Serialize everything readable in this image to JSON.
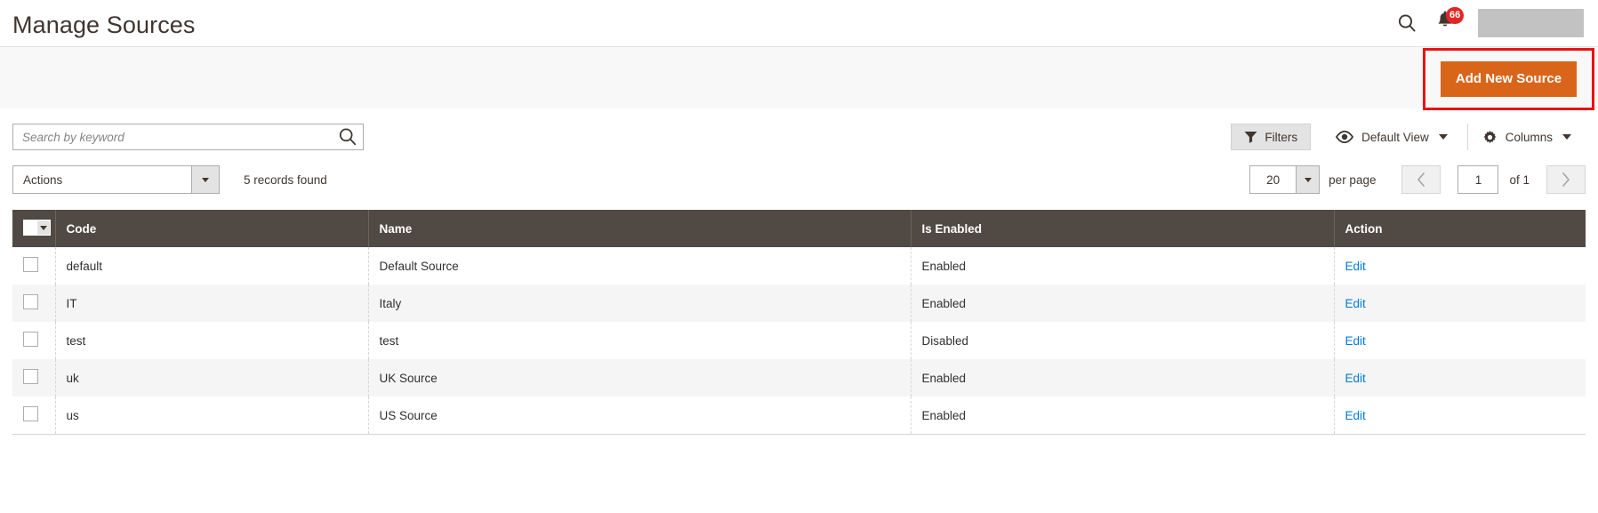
{
  "header": {
    "title": "Manage Sources",
    "search_icon": "search-icon",
    "notifications_icon": "bell-icon",
    "notifications_count": "66"
  },
  "button_bar": {
    "add_new_source_label": "Add New Source",
    "highlight_color": "#e81313",
    "button_color": "#d9651a"
  },
  "toolbar": {
    "search_placeholder": "Search by keyword",
    "search_value": "",
    "search_icon": "search-icon",
    "filters_label": "Filters",
    "filters_icon": "funnel-icon",
    "view_label": "Default View",
    "view_icon": "eye-icon",
    "columns_label": "Columns",
    "columns_icon": "gear-icon",
    "actions_label": "Actions",
    "records_found": "5 records found"
  },
  "pager": {
    "per_page_value": "20",
    "per_page_label": "per page",
    "prev_icon": "chevron-left-icon",
    "next_icon": "chevron-right-icon",
    "current_page": "1",
    "of_label": "of 1"
  },
  "grid": {
    "columns": [
      "Code",
      "Name",
      "Is Enabled",
      "Action"
    ],
    "rows": [
      {
        "code": "default",
        "name": "Default Source",
        "is_enabled": "Enabled",
        "action": "Edit"
      },
      {
        "code": "IT",
        "name": "Italy",
        "is_enabled": "Enabled",
        "action": "Edit"
      },
      {
        "code": "test",
        "name": "test",
        "is_enabled": "Disabled",
        "action": "Edit"
      },
      {
        "code": "uk",
        "name": "UK Source",
        "is_enabled": "Enabled",
        "action": "Edit"
      },
      {
        "code": "us",
        "name": "US Source",
        "is_enabled": "Enabled",
        "action": "Edit"
      }
    ]
  }
}
